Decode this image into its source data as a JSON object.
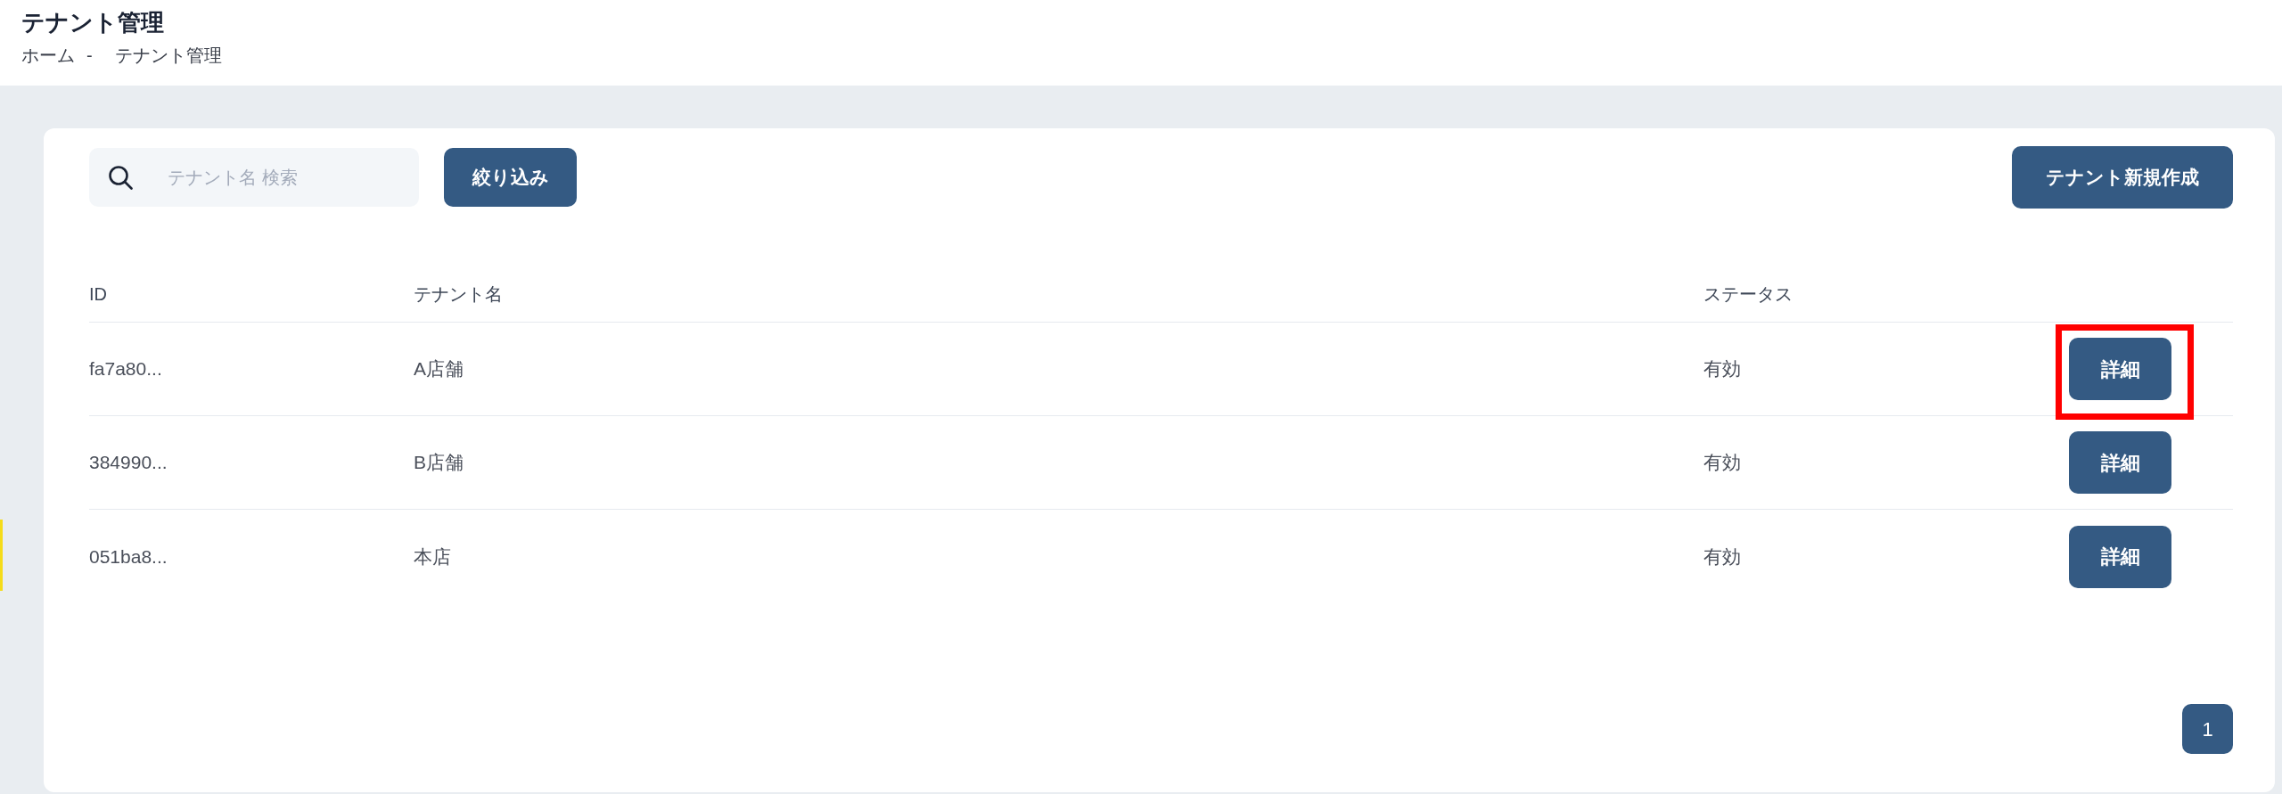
{
  "page_header": {
    "title": "テナント管理",
    "breadcrumb": {
      "items": [
        "ホーム",
        "テナント管理"
      ],
      "separator": "-"
    }
  },
  "toolbar": {
    "search": {
      "placeholder": "テナント名 検索"
    },
    "filter_button": "絞り込み",
    "create_button": "テナント新規作成"
  },
  "table": {
    "columns": [
      "ID",
      "テナント名",
      "ステータス"
    ],
    "rows": [
      {
        "id": "fa7a80...",
        "name": "A店舗",
        "status": "有効",
        "action": "詳細",
        "highlighted": true
      },
      {
        "id": "384990...",
        "name": "B店舗",
        "status": "有効",
        "action": "詳細",
        "highlighted": false
      },
      {
        "id": "051ba8...",
        "name": "本店",
        "status": "有効",
        "action": "詳細",
        "highlighted": false
      }
    ]
  },
  "pagination": {
    "pages": [
      {
        "label": "1",
        "selected": true
      }
    ]
  }
}
